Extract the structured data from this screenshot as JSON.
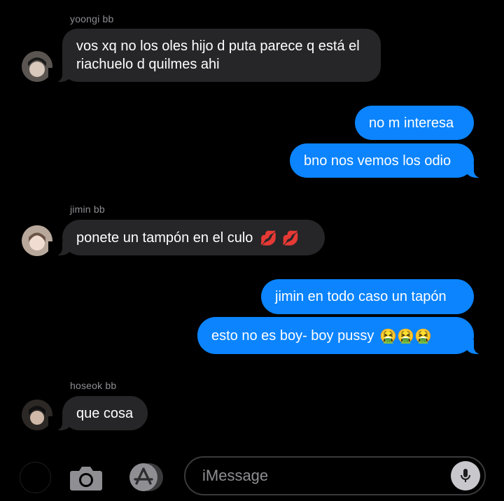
{
  "messages": [
    {
      "sender": "yoongi bb",
      "text": "vos xq no los oles hijo d puta parece q está el riachuelo d quilmes ahi",
      "direction": "incoming"
    },
    {
      "text": "no m interesa",
      "direction": "outgoing"
    },
    {
      "text": "bno nos vemos los odio",
      "direction": "outgoing"
    },
    {
      "sender": "jimin bb",
      "text": "ponete un tampón en el culo",
      "emoji": "💋 💋",
      "direction": "incoming"
    },
    {
      "text": "jimin en todo caso un tapón",
      "direction": "outgoing"
    },
    {
      "text": "esto no es boy- boy pussy",
      "emoji": "🤮🤮🤮",
      "direction": "outgoing"
    },
    {
      "sender": "hoseok bb",
      "text": "que cosa",
      "direction": "incoming"
    }
  ],
  "input": {
    "placeholder": "iMessage"
  },
  "icons": {
    "camera": "camera-icon",
    "app_store": "app-store-icon",
    "mic": "microphone-icon",
    "apps": "apps-circle-icon"
  },
  "colors": {
    "outgoing_bubble": "#0b84fe",
    "incoming_bubble": "#262628",
    "background": "#000000"
  }
}
